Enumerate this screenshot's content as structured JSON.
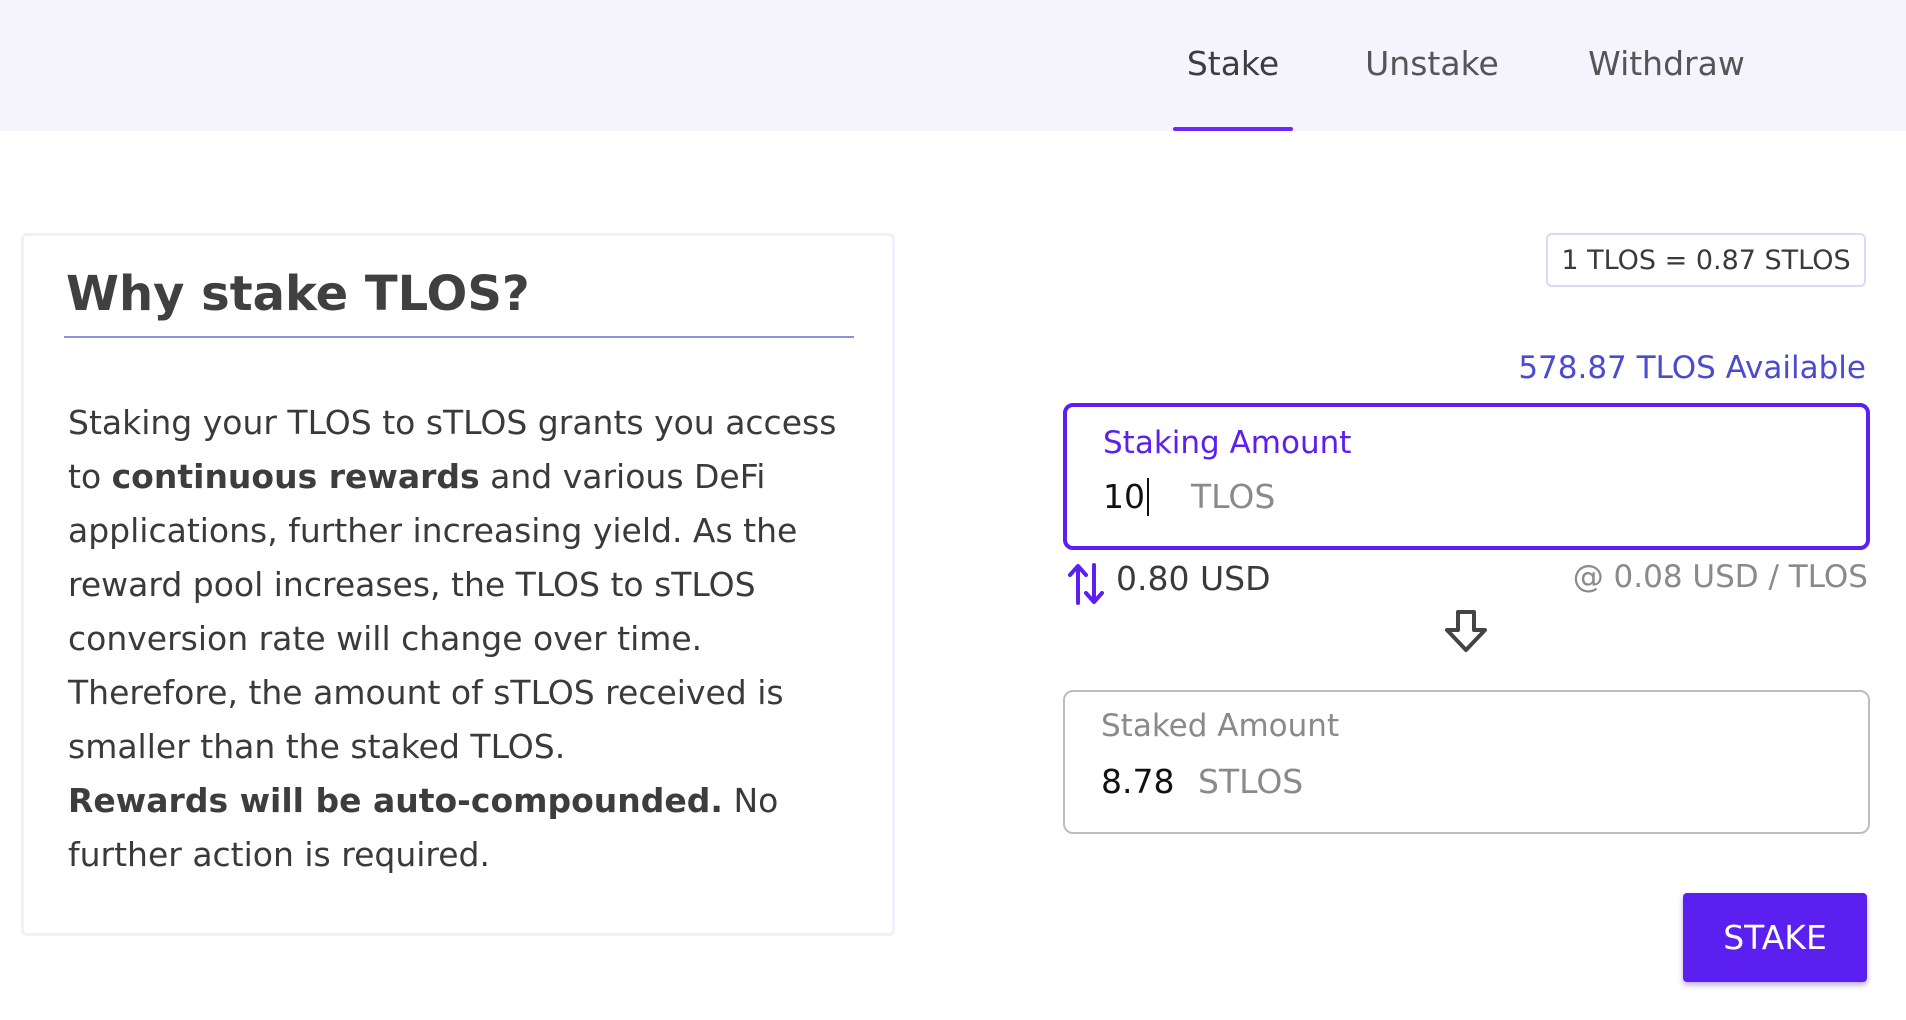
{
  "tabs": {
    "stake": "Stake",
    "unstake": "Unstake",
    "withdraw": "Withdraw",
    "active": "Stake"
  },
  "info_card": {
    "title": "Why stake TLOS?",
    "p1_before": "Staking your TLOS to sTLOS grants you access to ",
    "p1_bold": "continuous rewards",
    "p1_after": " and various DeFi applications, further increasing yield. As the reward pool increases, the TLOS to sTLOS conversion rate will change over time. Therefore, the amount of sTLOS received is smaller than the staked TLOS.",
    "p2_bold": "Rewards will be auto-compounded.",
    "p2_after": " No further action is required."
  },
  "rate_badge": "1 TLOS = 0.87 STLOS",
  "available": "578.87 TLOS Available",
  "staking_field": {
    "label": "Staking Amount",
    "value": "10",
    "unit": "TLOS"
  },
  "usd": {
    "value": "0.80 USD",
    "rate": "@ 0.08 USD / TLOS"
  },
  "staked_field": {
    "label": "Staked Amount",
    "value": "8.78",
    "unit": "STLOS"
  },
  "stake_button": "STAKE",
  "colors": {
    "accent": "#5b1ff0",
    "topbar_bg": "#f5f4fd",
    "available_text": "#4b4bd0"
  },
  "icons": {
    "swap": "swap-vertical-icon",
    "down_arrow": "arrow-down-icon"
  }
}
